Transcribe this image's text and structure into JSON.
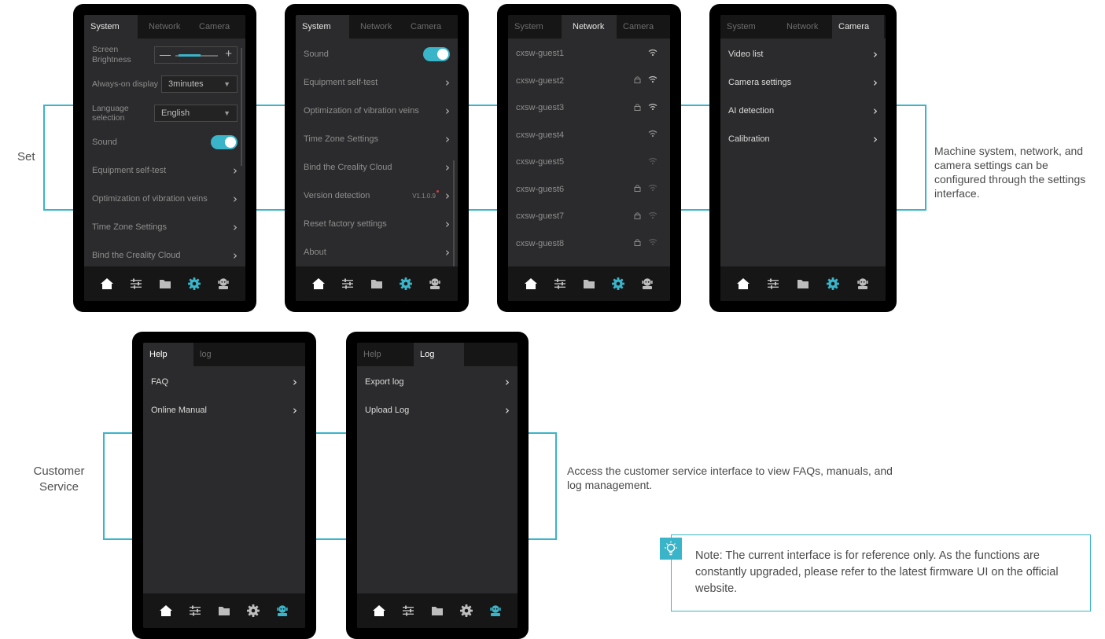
{
  "colors": {
    "accent": "#3ab4c9",
    "panel": "#2b2b2d",
    "bar": "#161616"
  },
  "labels": {
    "set": "Set",
    "set_desc": "Machine system, network, and camera settings can be configured through the settings interface.",
    "customer_service": "Customer Service",
    "customer_desc": "Access the customer service interface to view FAQs, manuals, and log management.",
    "note": "Note: The current interface is for reference only. As the functions are constantly upgraded, please refer to the latest firmware UI on the official website."
  },
  "settings_tabs": [
    "System",
    "Network",
    "Camera"
  ],
  "help_tabs": {
    "help": "Help",
    "log_lower": "log",
    "log": "Log"
  },
  "screen1": {
    "brightness_label": "Screen Brightness",
    "brightness_level": 0.35,
    "always_on_label": "Always-on display",
    "always_on_value": "3minutes",
    "language_label": "Language selection",
    "language_value": "English",
    "sound": "Sound",
    "rows": [
      "Equipment self-test",
      "Optimization of vibration veins",
      "Time Zone Settings",
      "Bind the Creality Cloud"
    ]
  },
  "screen2": {
    "sound": "Sound",
    "rows": [
      "Equipment self-test",
      "Optimization of vibration veins",
      "Time Zone Settings",
      "Bind the Creality Cloud"
    ],
    "version_label": "Version detection",
    "version_value": "V1.1.0.9",
    "rows2": [
      "Reset factory settings",
      "About"
    ]
  },
  "screen3": {
    "networks": [
      {
        "ssid": "cxsw-guest1",
        "locked": false
      },
      {
        "ssid": "cxsw-guest2",
        "locked": true
      },
      {
        "ssid": "cxsw-guest3",
        "locked": true
      },
      {
        "ssid": "cxsw-guest4",
        "locked": false
      },
      {
        "ssid": "cxsw-guest5",
        "locked": false
      },
      {
        "ssid": "cxsw-guest6",
        "locked": true
      },
      {
        "ssid": "cxsw-guest7",
        "locked": true
      },
      {
        "ssid": "cxsw-guest8",
        "locked": true
      }
    ]
  },
  "screen4": {
    "rows": [
      "Video list",
      "Camera settings",
      "AI detection",
      "Calibration"
    ]
  },
  "screen5": {
    "rows": [
      "FAQ",
      "Online Manual"
    ]
  },
  "screen6": {
    "rows": [
      "Export log",
      "Upload Log"
    ]
  },
  "icons": {
    "chevron": "›",
    "caret": "▼",
    "lock": "🔒︎",
    "wifi": "wifi-icon"
  },
  "nav_icons": [
    "home-icon",
    "sliders-icon",
    "folder-icon",
    "gear-icon",
    "support-icon"
  ]
}
